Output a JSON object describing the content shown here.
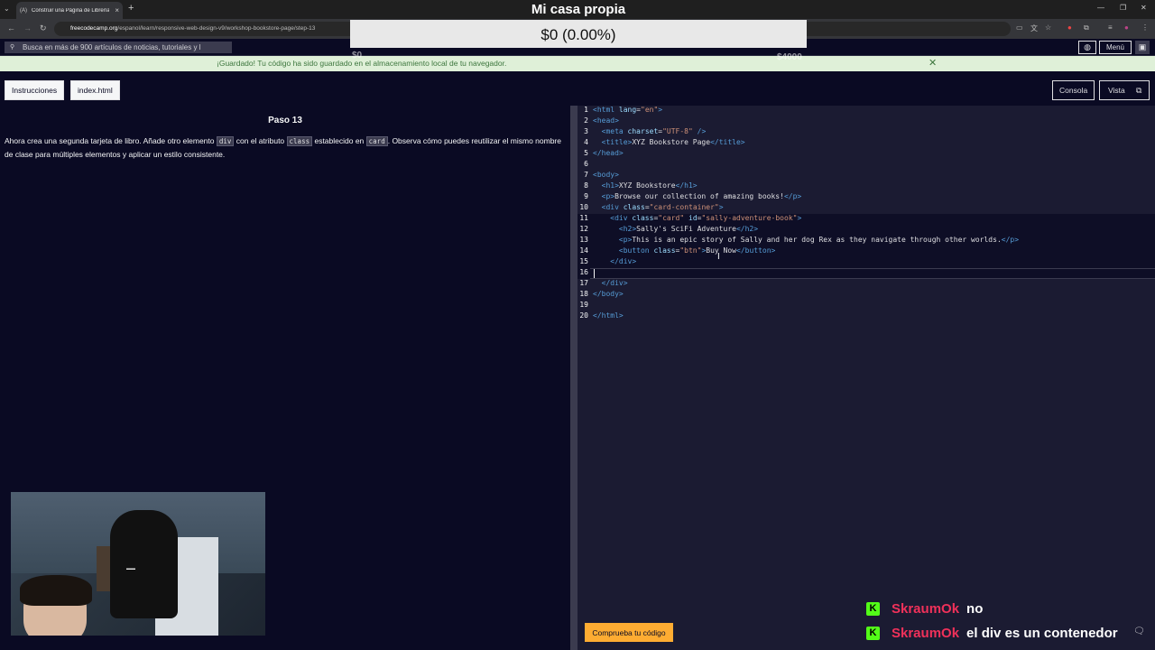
{
  "browser": {
    "tab_title": "Construir una Página de Librería",
    "url_host": "freecodecamp.org",
    "url_path": "/espanol/learn/responsive-web-design-v9/workshop-bookstore-page/step-13"
  },
  "nav": {
    "search_placeholder": "Busca en más de 900 artículos de noticias, tutoriales y l",
    "menu_label": "Menú"
  },
  "flash": {
    "message": "¡Guardado! Tu código ha sido guardado en el almacenamiento local de tu navegador."
  },
  "toolbar": {
    "instructions": "Instrucciones",
    "file": "index.html",
    "console": "Consola",
    "preview": "Vista"
  },
  "step": {
    "title": "Paso 13",
    "text_1": "Ahora crea una segunda tarjeta de libro. Añade otro elemento ",
    "code_1": "div",
    "text_2": " con el atributo ",
    "code_2": "class",
    "text_3": " establecido en ",
    "code_3": "card",
    "text_4": ". Observa cómo puedes reutilizar el mismo nombre de clase para múltiples elementos y aplicar un estilo consistente."
  },
  "editor": {
    "lines": [
      {
        "n": "1",
        "indent": "",
        "parts": [
          [
            "tg",
            "<html "
          ],
          [
            "at",
            "lang"
          ],
          [
            "tx",
            "="
          ],
          [
            "st",
            "\"en\""
          ],
          [
            "tg",
            ">"
          ]
        ]
      },
      {
        "n": "2",
        "indent": "",
        "parts": [
          [
            "tg",
            "<head>"
          ]
        ]
      },
      {
        "n": "3",
        "indent": "  ",
        "parts": [
          [
            "tg",
            "<meta "
          ],
          [
            "at",
            "charset"
          ],
          [
            "tx",
            "="
          ],
          [
            "st",
            "\"UTF-8\""
          ],
          [
            "tg",
            " />"
          ]
        ]
      },
      {
        "n": "4",
        "indent": "  ",
        "parts": [
          [
            "tg",
            "<title>"
          ],
          [
            "tx",
            "XYZ Bookstore Page"
          ],
          [
            "tg",
            "</title>"
          ]
        ]
      },
      {
        "n": "5",
        "indent": "",
        "parts": [
          [
            "tg",
            "</head>"
          ]
        ]
      },
      {
        "n": "6",
        "indent": "",
        "parts": []
      },
      {
        "n": "7",
        "indent": "",
        "parts": [
          [
            "tg",
            "<body>"
          ]
        ]
      },
      {
        "n": "8",
        "indent": "  ",
        "parts": [
          [
            "tg",
            "<h1>"
          ],
          [
            "tx",
            "XYZ Bookstore"
          ],
          [
            "tg",
            "</h1>"
          ]
        ]
      },
      {
        "n": "9",
        "indent": "  ",
        "parts": [
          [
            "tg",
            "<p>"
          ],
          [
            "tx",
            "Browse our collection of amazing books!"
          ],
          [
            "tg",
            "</p>"
          ]
        ]
      },
      {
        "n": "10",
        "indent": "  ",
        "parts": [
          [
            "tg",
            "<div "
          ],
          [
            "at",
            "class"
          ],
          [
            "tx",
            "="
          ],
          [
            "st",
            "\"card-container\""
          ],
          [
            "tg",
            ">"
          ]
        ]
      },
      {
        "n": "11",
        "indent": "    ",
        "parts": [
          [
            "tg",
            "<div "
          ],
          [
            "at",
            "class"
          ],
          [
            "tx",
            "="
          ],
          [
            "st",
            "\"card\""
          ],
          [
            "tx",
            " "
          ],
          [
            "at",
            "id"
          ],
          [
            "tx",
            "="
          ],
          [
            "st",
            "\"sally-adventure-book\""
          ],
          [
            "tg",
            ">"
          ]
        ]
      },
      {
        "n": "12",
        "indent": "      ",
        "parts": [
          [
            "tg",
            "<h2>"
          ],
          [
            "tx",
            "Sally's SciFi Adventure"
          ],
          [
            "tg",
            "</h2>"
          ]
        ]
      },
      {
        "n": "13",
        "indent": "      ",
        "parts": [
          [
            "tg",
            "<p>"
          ],
          [
            "tx",
            "This is an epic story of Sally and her dog Rex as they navigate through other worlds."
          ],
          [
            "tg",
            "</p>"
          ]
        ]
      },
      {
        "n": "14",
        "indent": "      ",
        "parts": [
          [
            "tg",
            "<button "
          ],
          [
            "at",
            "class"
          ],
          [
            "tx",
            "="
          ],
          [
            "st",
            "\"btn\""
          ],
          [
            "tg",
            ">"
          ],
          [
            "tx",
            "Buy Now"
          ],
          [
            "tg",
            "</button>"
          ]
        ]
      },
      {
        "n": "15",
        "indent": "    ",
        "parts": [
          [
            "tg",
            "</div>"
          ]
        ]
      },
      {
        "n": "16",
        "indent": "",
        "parts": []
      },
      {
        "n": "17",
        "indent": "  ",
        "parts": [
          [
            "tg",
            "</div>"
          ]
        ]
      },
      {
        "n": "18",
        "indent": "",
        "parts": [
          [
            "tg",
            "</body>"
          ]
        ]
      },
      {
        "n": "19",
        "indent": "",
        "parts": []
      },
      {
        "n": "20",
        "indent": "",
        "parts": [
          [
            "tg",
            "</html>"
          ]
        ]
      }
    ],
    "check_button": "Comprueba tu código"
  },
  "overlay": {
    "title": "Mi casa propia",
    "value": "$0 (0.00%)",
    "ghost_left": "$0",
    "ghost_right": "$4000"
  },
  "chat": [
    {
      "user": "SkraumOk",
      "message": "no"
    },
    {
      "user": "SkraumOk",
      "message": "el div es un contenedor"
    }
  ],
  "colors": {
    "background": "#0a0a23",
    "editor": "#1b1b32",
    "accent": "#feac32",
    "flash_bg": "#dff0d8"
  }
}
